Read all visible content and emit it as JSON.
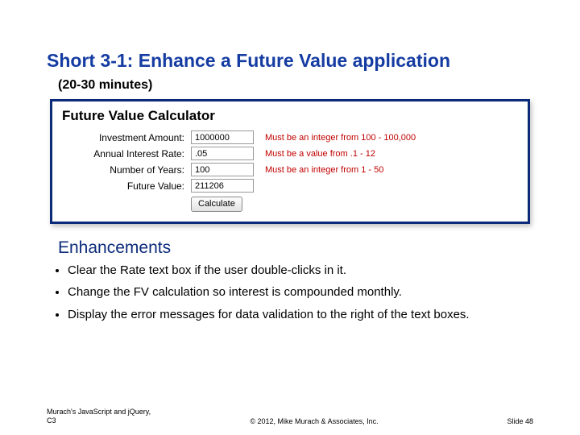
{
  "title": "Short 3-1: Enhance a Future Value application",
  "duration": "(20-30 minutes)",
  "calc": {
    "heading": "Future Value Calculator",
    "rows": [
      {
        "label": "Investment Amount:",
        "value": "1000000",
        "error": "Must be an integer from 100 - 100,000"
      },
      {
        "label": "Annual Interest Rate:",
        "value": ".05",
        "error": "Must be a value from .1 - 12"
      },
      {
        "label": "Number of Years:",
        "value": "100",
        "error": "Must be an integer from 1 - 50"
      },
      {
        "label": "Future Value:",
        "value": "211206",
        "error": ""
      }
    ],
    "button": "Calculate"
  },
  "enh_heading": "Enhancements",
  "bullets": [
    "Clear the Rate text box if the user double-clicks in it.",
    "Change the FV calculation so interest is compounded monthly.",
    "Display the error messages for data validation to the right of the text boxes."
  ],
  "footer": {
    "left": "Murach's JavaScript and jQuery, C3",
    "center": "© 2012, Mike Murach & Associates, Inc.",
    "right": "Slide 48"
  }
}
